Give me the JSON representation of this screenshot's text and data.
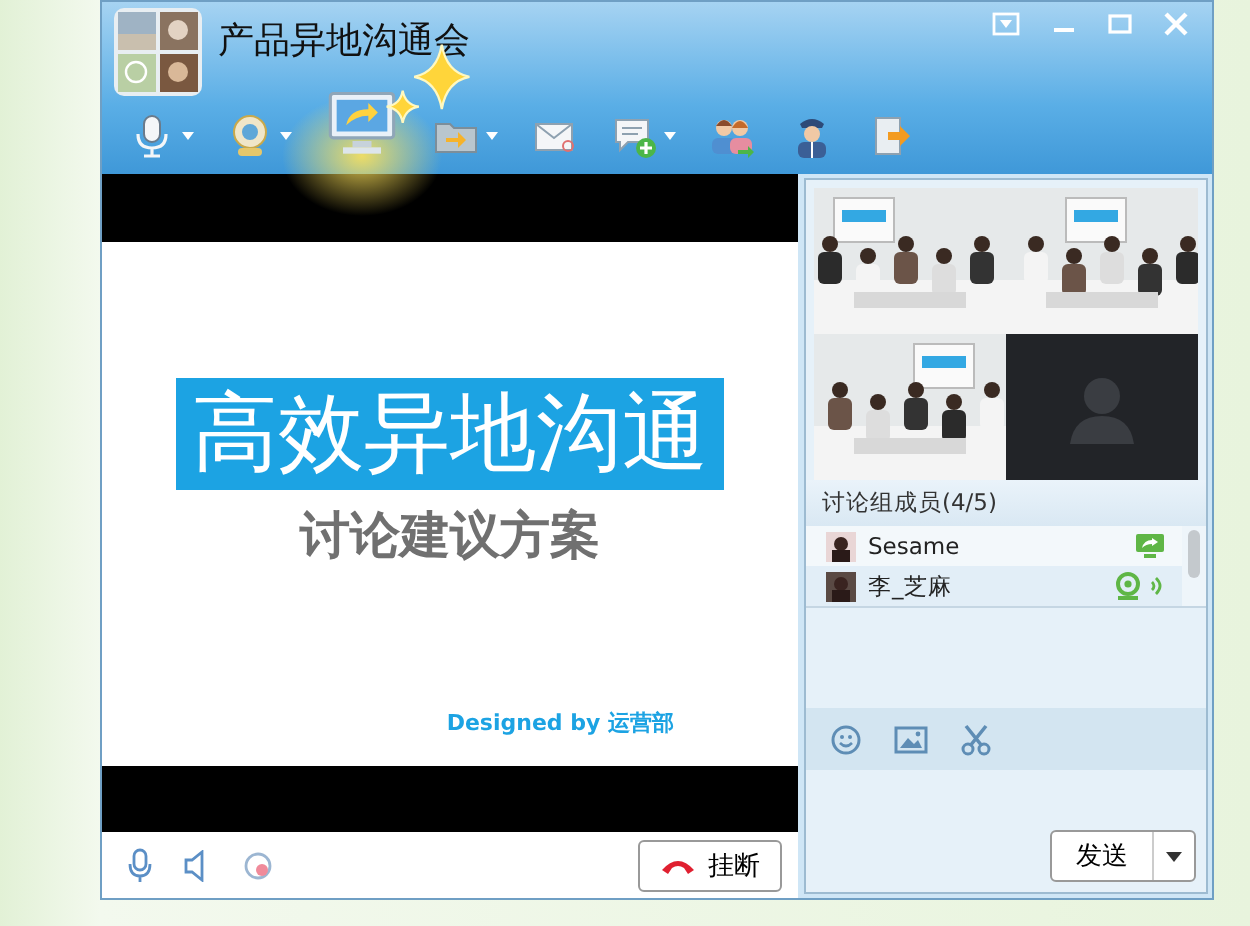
{
  "window": {
    "title": "产品异地沟通会"
  },
  "toolbar": [
    {
      "kind": "mic",
      "menu": true,
      "selected": false
    },
    {
      "kind": "camera",
      "menu": true,
      "selected": false
    },
    {
      "kind": "screen",
      "menu": false,
      "selected": true
    },
    {
      "kind": "folder",
      "menu": true,
      "selected": false
    },
    {
      "kind": "mail",
      "menu": false,
      "selected": false
    },
    {
      "kind": "chat",
      "menu": true,
      "selected": false
    },
    {
      "kind": "people",
      "menu": false,
      "selected": false
    },
    {
      "kind": "officer",
      "menu": false,
      "selected": false
    },
    {
      "kind": "exit",
      "menu": false,
      "selected": false
    }
  ],
  "slide": {
    "title": "高效异地沟通",
    "subtitle": "讨论建议方案",
    "credit": "Designed by 运营部"
  },
  "hangup_button": "挂断",
  "video_tiles": [
    {
      "kind": "picture"
    },
    {
      "kind": "picture"
    },
    {
      "kind": "picture"
    },
    {
      "kind": "empty"
    }
  ],
  "members": {
    "heading": "讨论组成员(4/5)",
    "items": [
      {
        "name": "Sesame",
        "sharing_screen": true,
        "camera": false
      },
      {
        "name": "李_芝麻",
        "sharing_screen": false,
        "camera": true
      }
    ]
  },
  "send_button": "发送"
}
